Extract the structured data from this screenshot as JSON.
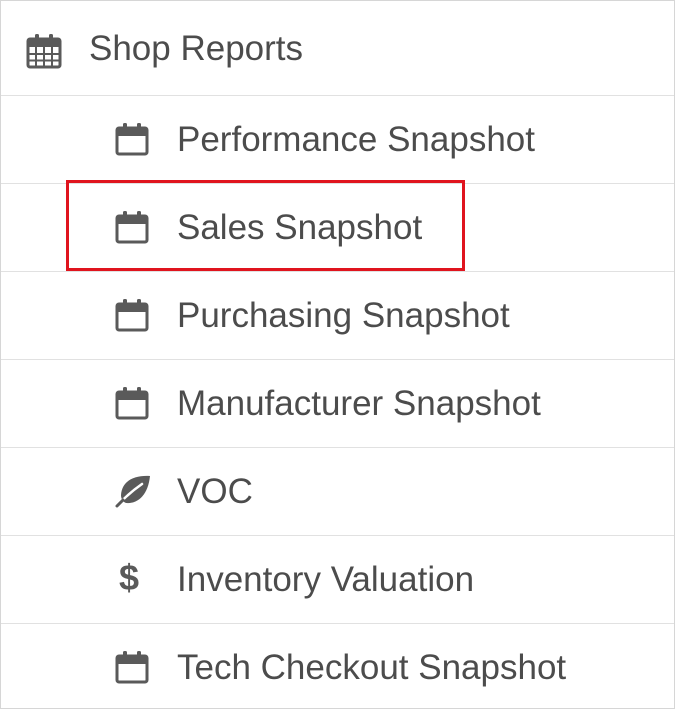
{
  "menu": {
    "header": {
      "label": "Shop Reports",
      "icon": "calendar-grid-icon"
    },
    "items": [
      {
        "label": "Performance Snapshot",
        "icon": "calendar-icon"
      },
      {
        "label": "Sales Snapshot",
        "icon": "calendar-icon",
        "highlighted": true
      },
      {
        "label": "Purchasing Snapshot",
        "icon": "calendar-icon"
      },
      {
        "label": "Manufacturer Snapshot",
        "icon": "calendar-icon"
      },
      {
        "label": "VOC",
        "icon": "leaf-icon"
      },
      {
        "label": "Inventory Valuation",
        "icon": "dollar-icon",
        "glyph": "$"
      },
      {
        "label": "Tech Checkout Snapshot",
        "icon": "calendar-icon"
      }
    ]
  },
  "colors": {
    "text": "#4c4c4c",
    "icon": "#5a5a5a",
    "divider": "#e1e1e1",
    "highlight": "#e0141e"
  }
}
